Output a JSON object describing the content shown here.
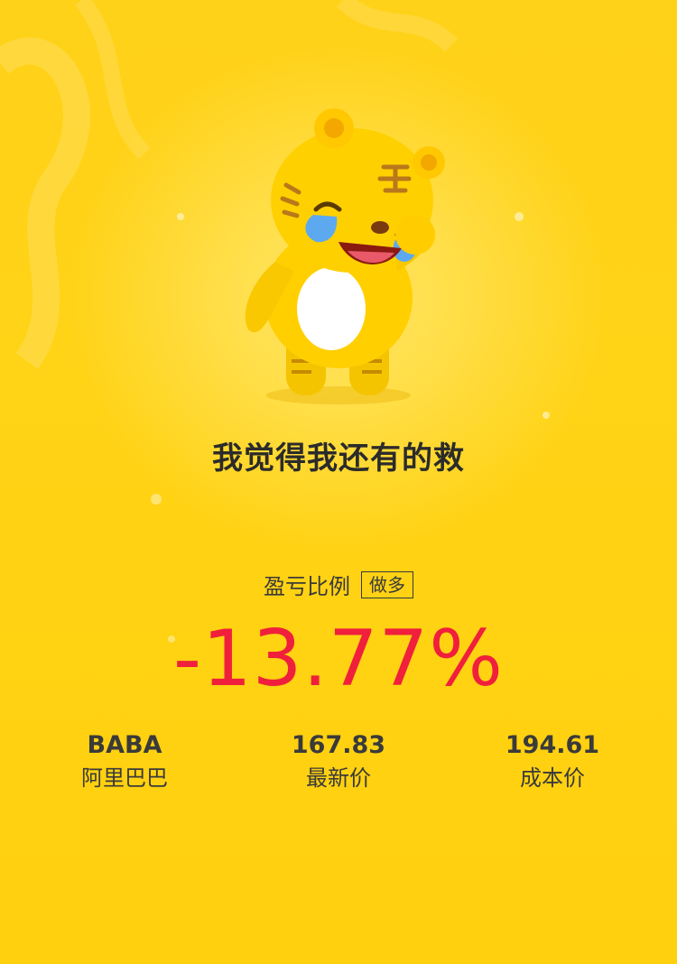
{
  "slogan": "我觉得我还有的救",
  "ratio": {
    "label": "盈亏比例",
    "badge": "做多",
    "value": "-13.77%"
  },
  "stats": [
    {
      "value": "BABA",
      "label": "阿里巴巴"
    },
    {
      "value": "167.83",
      "label": "最新价"
    },
    {
      "value": "194.61",
      "label": "成本价"
    }
  ],
  "colors": {
    "background": "#FFD21A",
    "percent": "#F01F3C",
    "text": "#3a3a3a"
  },
  "illustration": "crying-tiger-mascot"
}
